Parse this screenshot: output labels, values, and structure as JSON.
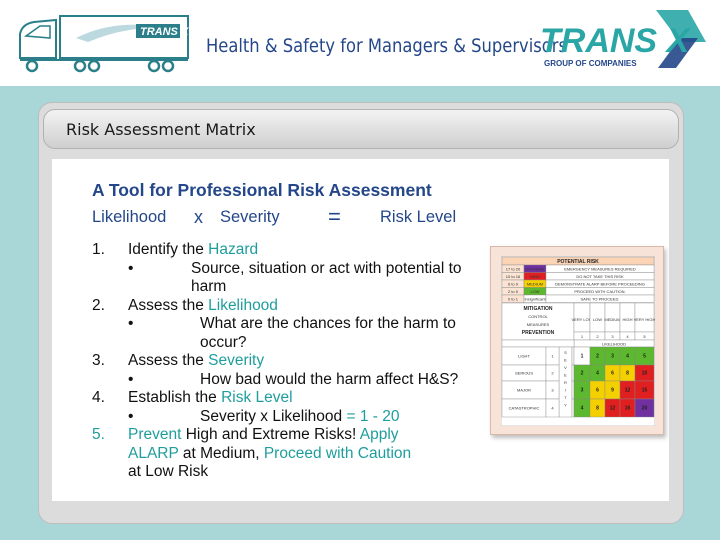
{
  "header": {
    "title": "Health & Safety for Managers & Supervisors",
    "truck_logo_text": "TRANS X",
    "brand": {
      "name": "TRANS X",
      "tagline": "GROUP OF COMPANIES"
    }
  },
  "slide": {
    "title": "Risk Assessment Matrix",
    "heading": "A Tool for Professional Risk Assessment",
    "formula": {
      "likelihood": "Likelihood",
      "x": "x",
      "severity": "Severity",
      "equals": "=",
      "risk_level": "Risk Level"
    },
    "steps": [
      {
        "number": "1.",
        "text": "Identify the ",
        "highlight": "Hazard",
        "sub": "Source, situation or act with potential to harm"
      },
      {
        "number": "2.",
        "text": "Assess the ",
        "highlight": "Likelihood",
        "sub": "What are the chances for the harm to occur?"
      },
      {
        "number": "3.",
        "text": "Assess the ",
        "highlight": "Severity",
        "sub": "How bad would the harm affect H&S?"
      },
      {
        "number": "4.",
        "text": "Establish the ",
        "highlight": "Risk Level",
        "sub": "Severity x Likelihood",
        "sub_highlight": "= 1 - 20"
      },
      {
        "number": "5.",
        "prevent": "Prevent",
        "mid1": " High and Extreme Risks! ",
        "apply": "Apply ALARP",
        "mid2": " at Medium, ",
        "proceed": "Proceed with Caution",
        "end": " at Low Risk"
      }
    ]
  },
  "matrix": {
    "title": "POTENTIAL RISK",
    "risk_rows": [
      {
        "range": "17 to 20",
        "level": "EXTREME",
        "action": "EMERGENCY MEASURES REQUIRED",
        "color": "#7030a0"
      },
      {
        "range": "10 to 16",
        "level": "HIGH",
        "action": "DO NOT TAKE THIS RISK",
        "color": "#e02020"
      },
      {
        "range": "6 to 9",
        "level": "MEDIUM",
        "action": "DEMONSTRATE ALARP BEFORE PROCEEDING",
        "color": "#f5d000"
      },
      {
        "range": "2 to 5",
        "level": "LOW",
        "action": "PROCEED WITH CAUTION.",
        "color": "#5cb82e"
      },
      {
        "range": "0 to 1",
        "level": "Insignificant",
        "action": "SAFE TO PROCEED.",
        "color": "#ffffff"
      }
    ],
    "mitigation": [
      "MITIGATION",
      "CONTROL",
      "MEASURES",
      "PREVENTION"
    ],
    "likelihood_headers": [
      "VERY LOW",
      "LOW",
      "MEDIUM",
      "HIGH",
      "VERY HIGH"
    ],
    "likelihood_numbers": [
      "1",
      "2",
      "3",
      "4",
      "5"
    ],
    "likelihood_label": "LIKELIHOOD",
    "severity_label": "SEVERITY",
    "severity_rows": [
      {
        "name": "LIGHT",
        "n": "1",
        "cells": [
          "1",
          "2",
          "3",
          "4",
          "5"
        ]
      },
      {
        "name": "SERIOUS",
        "n": "2",
        "cells": [
          "2",
          "4",
          "6",
          "8",
          "10"
        ]
      },
      {
        "name": "MAJOR",
        "n": "3",
        "cells": [
          "3",
          "6",
          "9",
          "12",
          "15"
        ]
      },
      {
        "name": "CATASTROPHIC",
        "n": "4",
        "cells": [
          "4",
          "8",
          "12",
          "16",
          "20"
        ]
      }
    ],
    "colors": {
      "extreme": "#7030a0",
      "high": "#e02020",
      "medium": "#f5d000",
      "low": "#5cb82e",
      "none": "#ffffff"
    }
  },
  "colors": {
    "accent_teal": "#1f9d9d",
    "navy": "#24478a",
    "background_teal": "#a9d6d6"
  }
}
